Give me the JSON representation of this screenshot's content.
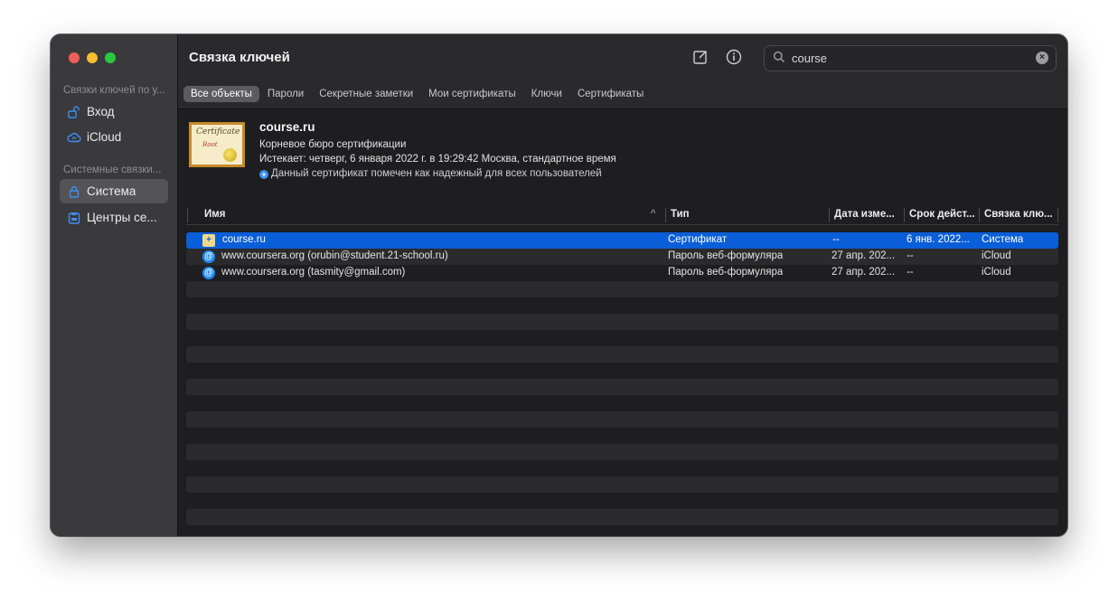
{
  "window": {
    "title": "Связка ключей"
  },
  "sidebar": {
    "section1": "Связки ключей по у...",
    "items1": [
      {
        "label": "Вход",
        "icon": "lock-open-icon"
      },
      {
        "label": "iCloud",
        "icon": "cloud-icon"
      }
    ],
    "section2": "Системные связки...",
    "items2": [
      {
        "label": "Система",
        "icon": "lock-icon",
        "selected": true
      },
      {
        "label": "Центры се...",
        "icon": "archive-icon"
      }
    ]
  },
  "toolbar": {
    "edit_icon": "compose-icon",
    "info_icon": "info-icon",
    "search_value": "course"
  },
  "tabs": [
    "Все объекты",
    "Пароли",
    "Секретные заметки",
    "Мои сертификаты",
    "Ключи",
    "Сертификаты"
  ],
  "active_tab": "Все объекты",
  "detail": {
    "name": "course.ru",
    "kind": "Корневое бюро сертификации",
    "expires": "Истекает: четверг, 6 января 2022 г. в 19:29:42 Москва, стандартное время",
    "trust": "Данный сертификат помечен как надежный для всех пользователей",
    "cert_text1": "Certificate",
    "cert_text2": "Root"
  },
  "table": {
    "columns": [
      "Имя",
      "Тип",
      "Дата изме...",
      "Срок дейст...",
      "Связка клю..."
    ],
    "rows": [
      {
        "name": "course.ru",
        "type": "Сертификат",
        "modified": "--",
        "expires": "6 янв. 2022...",
        "keychain": "Система",
        "icon": "certificate-icon",
        "selected": true
      },
      {
        "name": "www.coursera.org (orubin@student.21-school.ru)",
        "type": "Пароль веб-формуляра",
        "modified": "27 апр. 202...",
        "expires": "--",
        "keychain": "iCloud",
        "icon": "at-sign-icon",
        "selected": false
      },
      {
        "name": "www.coursera.org (tasmity@gmail.com)",
        "type": "Пароль веб-формуляра",
        "modified": "27 апр. 202...",
        "expires": "--",
        "keychain": "iCloud",
        "icon": "at-sign-icon",
        "selected": false
      }
    ]
  },
  "colors": {
    "selection": "#0a5ed7",
    "sidebar_bg": "#3a393c",
    "content_bg": "#1e1e20"
  }
}
